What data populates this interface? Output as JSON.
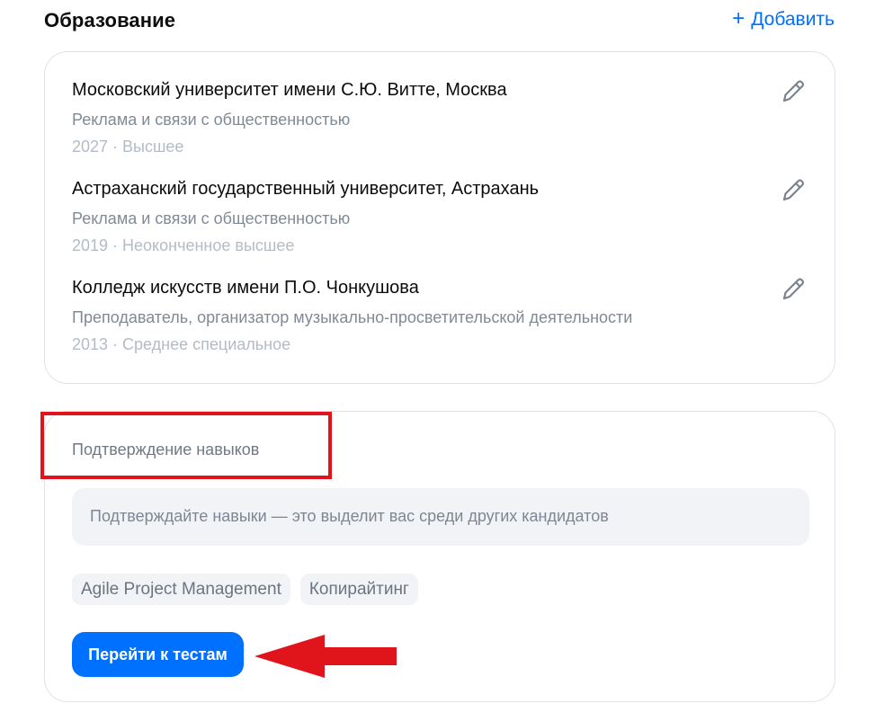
{
  "education": {
    "title": "Образование",
    "add_label": "Добавить",
    "items": [
      {
        "name": "Московский университет имени С.Ю. Витте, Москва",
        "specialty": "Реклама и связи с общественностью",
        "meta": "2027 · Высшее"
      },
      {
        "name": "Астраханский государственный университет, Астрахань",
        "specialty": "Реклама и связи с общественностью",
        "meta": "2019 · Неоконченное высшее"
      },
      {
        "name": "Колледж искусств имени П.О. Чонкушова",
        "specialty": "Преподаватель, организатор музыкально-просветительской деятельности",
        "meta": "2013 · Среднее специальное"
      }
    ]
  },
  "skills": {
    "heading": "Подтверждение навыков",
    "hint": "Подтверждайте навыки — это выделит вас среди других кандидатов",
    "chips": [
      "Agile Project Management",
      "Копирайтинг"
    ],
    "button_label": "Перейти к тестам"
  },
  "colors": {
    "accent": "#0070ff",
    "annotation": "#e0141b",
    "muted_text": "#7f8a96",
    "light_text": "#b3bcc6",
    "chip_bg": "#f1f3f6"
  },
  "icons": {
    "add": "plus-icon",
    "edit": "pencil-icon",
    "annotation": "red-arrow-annotation"
  }
}
